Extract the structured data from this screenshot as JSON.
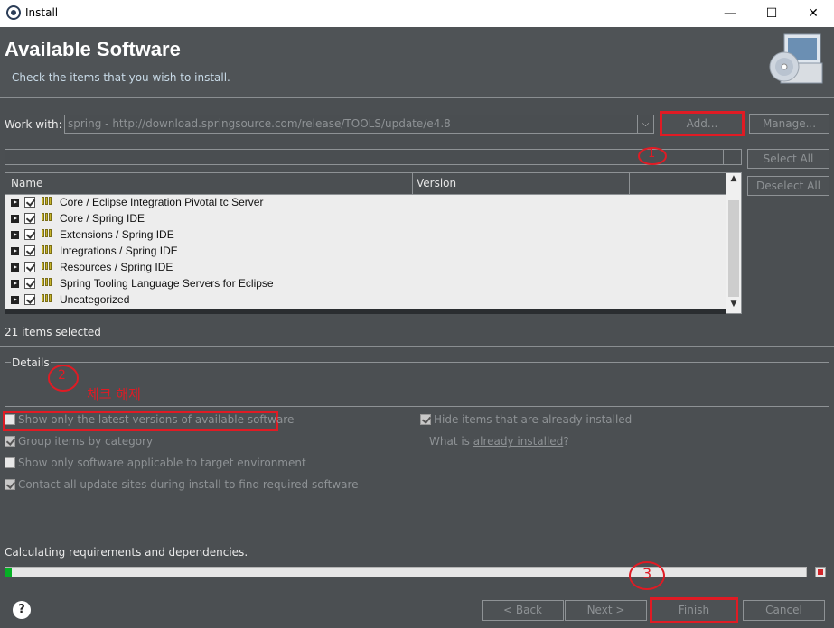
{
  "window": {
    "title": "Install",
    "minimize": "—",
    "maximize": "☐",
    "close": "✕"
  },
  "header": {
    "title": "Available Software",
    "subtitle": "Check the items that you wish to install."
  },
  "work_with": {
    "label": "Work with:",
    "value": "spring - http://download.springsource.com/release/TOOLS/update/e4.8",
    "add_button": "Add...",
    "manage_button": "Manage..."
  },
  "filter": {
    "value": ""
  },
  "side_buttons": {
    "select_all": "Select All",
    "deselect_all": "Deselect All"
  },
  "table": {
    "columns": [
      "Name",
      "Version"
    ],
    "rows": [
      "Core / Eclipse Integration Pivotal tc Server",
      "Core / Spring IDE",
      "Extensions / Spring IDE",
      "Integrations / Spring IDE",
      "Resources / Spring IDE",
      "Spring Tooling Language Servers for Eclipse",
      "Uncategorized"
    ]
  },
  "selection_status": "21 items selected",
  "details": {
    "label": "Details"
  },
  "options": {
    "latest_versions": "Show only the latest versions of available software",
    "group_by_category": "Group items by category",
    "target_env": "Show only software applicable to target environment",
    "contact_sites": "Contact all update sites during install to find required software",
    "hide_installed": "Hide items that are already installed",
    "what_is_prefix": "What is",
    "already_installed_link": "already installed",
    "what_is_suffix": "?"
  },
  "progress": {
    "label": "Calculating requirements and dependencies.",
    "percent": 0.8
  },
  "annotations": {
    "one": "1",
    "two": "2",
    "two_text": "체크 해제",
    "three": "3"
  },
  "footer": {
    "help": "?",
    "back": "< Back",
    "next": "Next >",
    "finish": "Finish",
    "cancel": "Cancel"
  }
}
